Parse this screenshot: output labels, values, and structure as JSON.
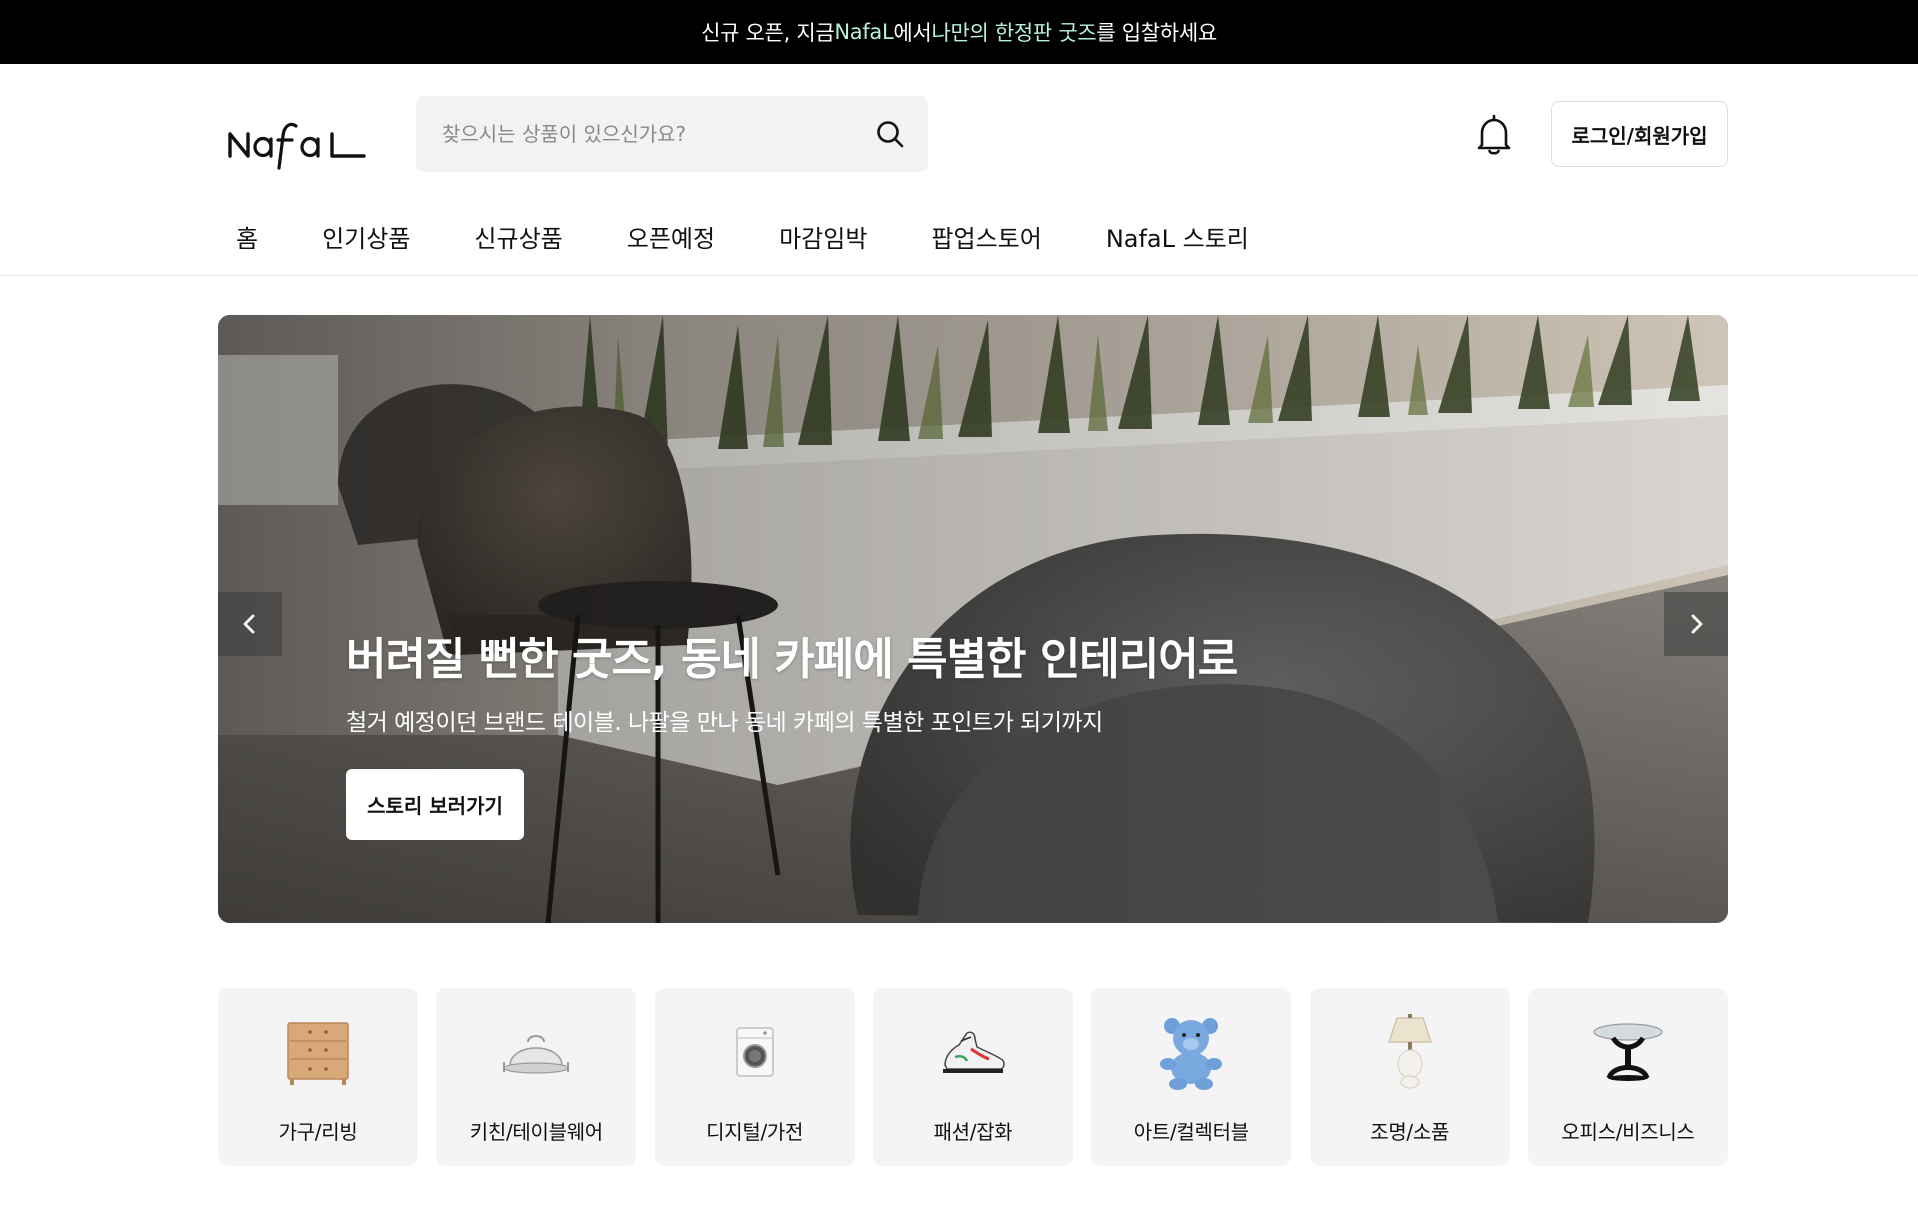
{
  "announcement": {
    "pre": "신규 오픈, 지금 ",
    "brand": "NafaL",
    "mid": "에서 ",
    "highlight": "나만의 한정판 굿즈",
    "post": "를 입찰하세요"
  },
  "header": {
    "logo_text": "Nafal",
    "search": {
      "placeholder": "찾으시는 상품이 있으신가요?",
      "value": ""
    },
    "login_label": "로그인/회원가입"
  },
  "nav": {
    "items": [
      {
        "label": "홈"
      },
      {
        "label": "인기상품"
      },
      {
        "label": "신규상품"
      },
      {
        "label": "오픈예정"
      },
      {
        "label": "마감임박"
      },
      {
        "label": "팝업스토어"
      },
      {
        "label": "NafaL 스토리"
      }
    ]
  },
  "hero": {
    "title": "버려질 뻔한 굿즈, 동네 카페에 특별한 인테리어로",
    "subtitle": "철거 예정이던 브랜드 테이블. 나팔을 만나 동네 카페의 특별한 포인트가 되기까지",
    "cta_label": "스토리 보러가기"
  },
  "categories": [
    {
      "label": "가구/리빙",
      "icon": "dresser-icon"
    },
    {
      "label": "키친/테이블웨어",
      "icon": "cloche-icon"
    },
    {
      "label": "디지털/가전",
      "icon": "washing-machine-icon"
    },
    {
      "label": "패션/잡화",
      "icon": "sneaker-icon"
    },
    {
      "label": "아트/컬렉터블",
      "icon": "teddy-bear-icon"
    },
    {
      "label": "조명/소품",
      "icon": "lamp-icon"
    },
    {
      "label": "오피스/비즈니스",
      "icon": "side-table-icon"
    }
  ],
  "colors": {
    "announce_bg": "#000000",
    "announce_highlight": "#b9f0d8",
    "card_bg": "#f4f4f4"
  }
}
